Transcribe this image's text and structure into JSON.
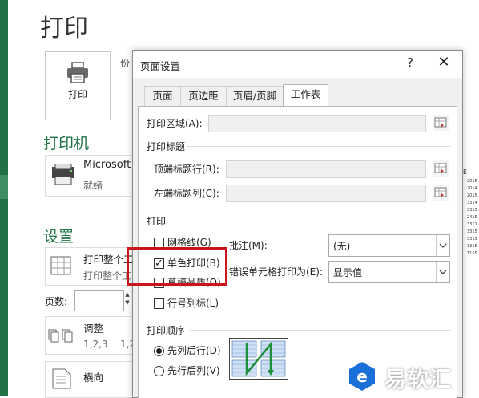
{
  "backstage": {
    "title": "打印",
    "print_button_label": "打印",
    "copies_label_fragment": "份",
    "printer_section_title": "打印机",
    "printer_name": "Microsoft",
    "printer_status": "就绪",
    "settings_section_title": "设置",
    "setting_print_scope_title": "打印整个工",
    "setting_print_scope_sub": "打印整个工",
    "pages_label": "页数:",
    "collate_title": "调整",
    "collate_sub": "1,2,3",
    "collate_sub_2": "1,2",
    "orientation_title": "横向"
  },
  "dialog": {
    "title": "页面设置",
    "help": "?",
    "close": "✕",
    "tabs": [
      "页面",
      "页边距",
      "页眉/页脚",
      "工作表"
    ],
    "active_tab": "工作表",
    "print_area_label": "打印区域(A):",
    "print_titles_group": "打印标题",
    "rows_repeat_label": "顶端标题行(R):",
    "cols_repeat_label": "左端标题列(C):",
    "print_group": "打印",
    "gridlines_label": "网格线(G)",
    "gridlines_checked": false,
    "bw_label": "单色打印(B)",
    "bw_checked": true,
    "draft_label": "草稿品质(Q)",
    "draft_checked": false,
    "headings_label": "行号列标(L)",
    "headings_checked": false,
    "comments_label": "批注(M):",
    "comments_value": "(无)",
    "errors_label": "错误单元格打印为(E):",
    "errors_value": "显示值",
    "order_group": "打印顺序",
    "order_down_then_over": "先列后行(D)",
    "order_over_then_down": "先行后列(V)",
    "order_selected": "先列后行(D)"
  },
  "preview_fragment": {
    "header": "E",
    "values": [
      "2015",
      "2014",
      "2015",
      "3314",
      "3315",
      "2415",
      "3311",
      "3315",
      "3315",
      "3315",
      "1155"
    ]
  },
  "watermark": {
    "text": "易软汇"
  },
  "colors": {
    "excel_green": "#217346",
    "highlight_red": "#c8161e",
    "watermark_blue": "#1b6fd8"
  }
}
